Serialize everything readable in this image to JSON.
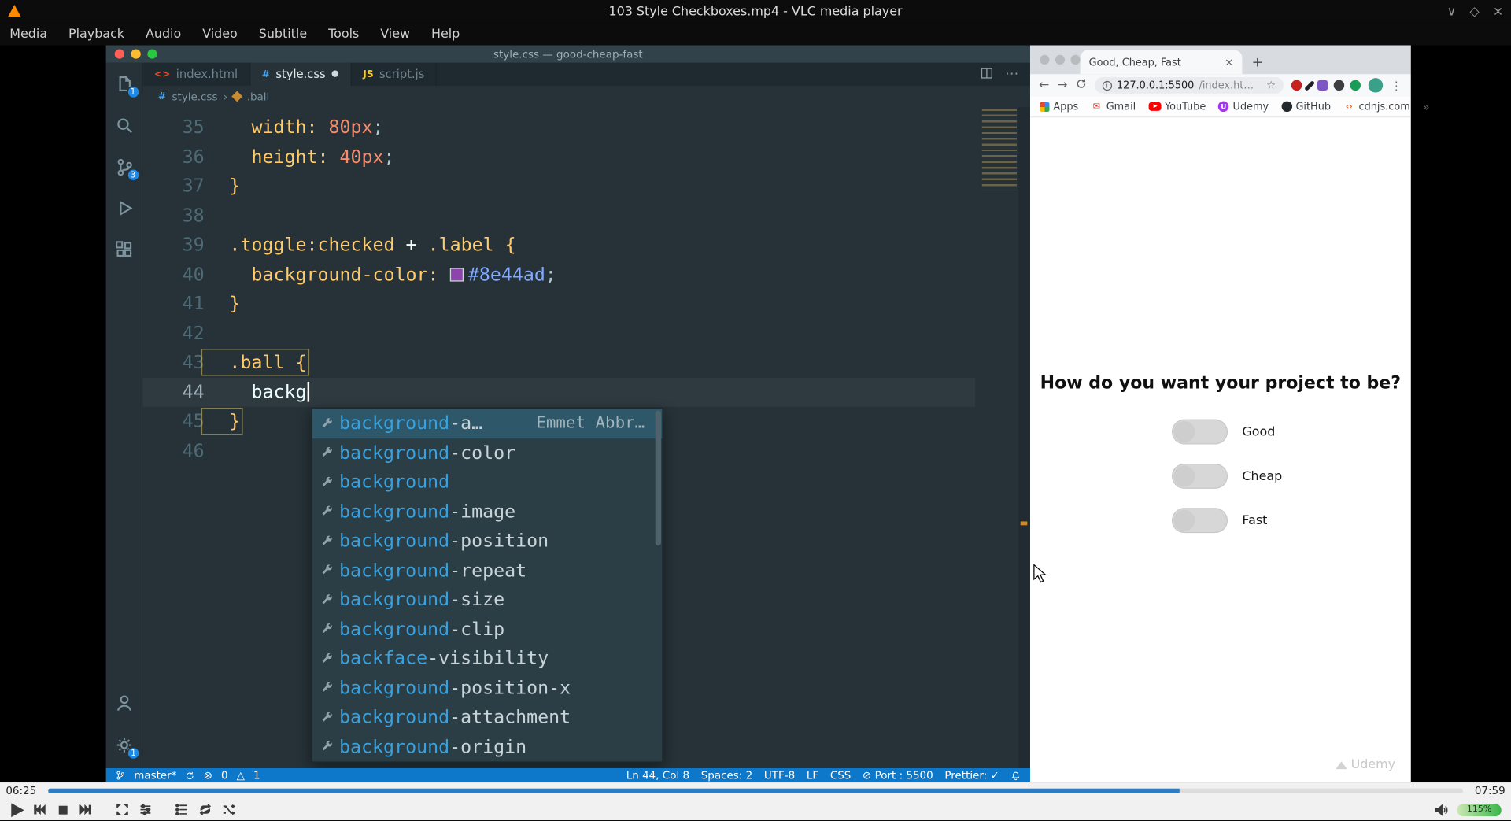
{
  "vlc": {
    "window_title": "103 Style Checkboxes.mp4 - VLC media player",
    "menu": [
      "Media",
      "Playback",
      "Audio",
      "Video",
      "Subtitle",
      "Tools",
      "View",
      "Help"
    ],
    "window_buttons": {
      "minimize": "∨",
      "restore": "◇",
      "close": "×"
    },
    "time_elapsed": "06:25",
    "time_total": "07:59",
    "progress_pct": 80,
    "volume_label": "115%",
    "volume_fill_pct": 100
  },
  "vscode": {
    "titlebar": "style.css — good-cheap-fast",
    "tabs": [
      {
        "name": "index.html",
        "icon_name": "html-file-icon",
        "icon_glyph": "<>",
        "icon_class": "ic-html",
        "active": false,
        "modified": false
      },
      {
        "name": "style.css",
        "icon_name": "css-file-icon",
        "icon_glyph": "#",
        "icon_class": "ic-css",
        "active": true,
        "modified": true
      },
      {
        "name": "script.js",
        "icon_name": "js-file-icon",
        "icon_glyph": "JS",
        "icon_class": "ic-js",
        "active": false,
        "modified": false
      }
    ],
    "tab_actions": {
      "more": "⋯"
    },
    "breadcrumb": {
      "file_icon": "#",
      "file": "style.css",
      "sep": "›",
      "symbol": ".ball"
    },
    "activity_badges": {
      "explorer": "1",
      "scm": "3",
      "settings": "1"
    },
    "code_lines": [
      {
        "n": 35,
        "tok": [
          [
            "  width:",
            "prop"
          ],
          [
            " 80px",
            "num"
          ],
          [
            ";",
            "punc"
          ]
        ]
      },
      {
        "n": 36,
        "tok": [
          [
            "  height:",
            "prop"
          ],
          [
            " 40px",
            "num"
          ],
          [
            ";",
            "punc"
          ]
        ]
      },
      {
        "n": 37,
        "tok": [
          [
            "}",
            "brace"
          ]
        ]
      },
      {
        "n": 38,
        "tok": []
      },
      {
        "n": 39,
        "tok": [
          [
            ".toggle:checked",
            "sel"
          ],
          [
            " + ",
            "plain"
          ],
          [
            ".label",
            "sel"
          ],
          [
            " {",
            "brace"
          ]
        ]
      },
      {
        "n": 40,
        "tok": [
          [
            "  background-color:",
            "prop"
          ],
          [
            " ",
            "plain"
          ],
          [
            "#8e44ad",
            "swatch"
          ],
          [
            "#8e44ad",
            "val"
          ],
          [
            ";",
            "punc"
          ]
        ]
      },
      {
        "n": 41,
        "tok": [
          [
            "}",
            "brace"
          ]
        ]
      },
      {
        "n": 42,
        "tok": []
      },
      {
        "n": 43,
        "tok": [
          [
            ".ball",
            "sel"
          ],
          [
            " {",
            "brace"
          ]
        ],
        "boxed": true
      },
      {
        "n": 44,
        "tok": [
          [
            "  backg",
            "plain"
          ]
        ],
        "cursor": true,
        "current": true
      },
      {
        "n": 45,
        "tok": [
          [
            "}",
            "brace"
          ]
        ],
        "boxed": true
      },
      {
        "n": 46,
        "tok": []
      }
    ],
    "suggest": {
      "items": [
        {
          "match": "background",
          "rest": "-a…",
          "detail": "Emmet Abbr…",
          "selected": true
        },
        {
          "match": "background",
          "rest": "-color"
        },
        {
          "match": "background",
          "rest": ""
        },
        {
          "match": "background",
          "rest": "-image"
        },
        {
          "match": "background",
          "rest": "-position"
        },
        {
          "match": "background",
          "rest": "-repeat"
        },
        {
          "match": "background",
          "rest": "-size"
        },
        {
          "match": "background",
          "rest": "-clip"
        },
        {
          "match": "backface",
          "rest": "-visibility"
        },
        {
          "match": "background",
          "rest": "-position-x"
        },
        {
          "match": "background",
          "rest": "-attachment"
        },
        {
          "match": "background",
          "rest": "-origin"
        }
      ]
    },
    "status": {
      "branch": "master*",
      "error_icon": "⊗",
      "errors": "0",
      "warning_icon": "△",
      "warnings": "1",
      "right": [
        "Ln 44, Col 8",
        "Spaces: 2",
        "UTF-8",
        "LF",
        "CSS",
        "⊘ Port : 5500",
        "Prettier: ✓"
      ]
    }
  },
  "browser": {
    "tab_title": "Good, Cheap, Fast",
    "tab_close": "×",
    "new_tab": "+",
    "nav": {
      "back": "←",
      "forward": "→",
      "info": "i",
      "star": "☆",
      "menu": "⋮"
    },
    "url_host": "127.0.0.1:5500",
    "url_path": "/index.ht…",
    "bookmarks": [
      {
        "label": "Apps",
        "icon": "apps",
        "glyph": ""
      },
      {
        "label": "Gmail",
        "icon": "gmail",
        "glyph": "✉"
      },
      {
        "label": "YouTube",
        "icon": "youtube",
        "glyph": ""
      },
      {
        "label": "Udemy",
        "icon": "udemy",
        "glyph": "U"
      },
      {
        "label": "GitHub",
        "icon": "github",
        "glyph": ""
      },
      {
        "label": "cdnjs.com",
        "icon": "cdnjs",
        "glyph": "‹›"
      }
    ],
    "bookmarks_overflow": "»",
    "extensions": [
      "ext-red",
      "ext-pen",
      "ext-puzzle",
      "ext-pin",
      "ext-green"
    ],
    "page": {
      "heading": "How do you want your project to be?",
      "options": [
        "Good",
        "Cheap",
        "Fast"
      ],
      "watermark": "Udemy"
    }
  }
}
